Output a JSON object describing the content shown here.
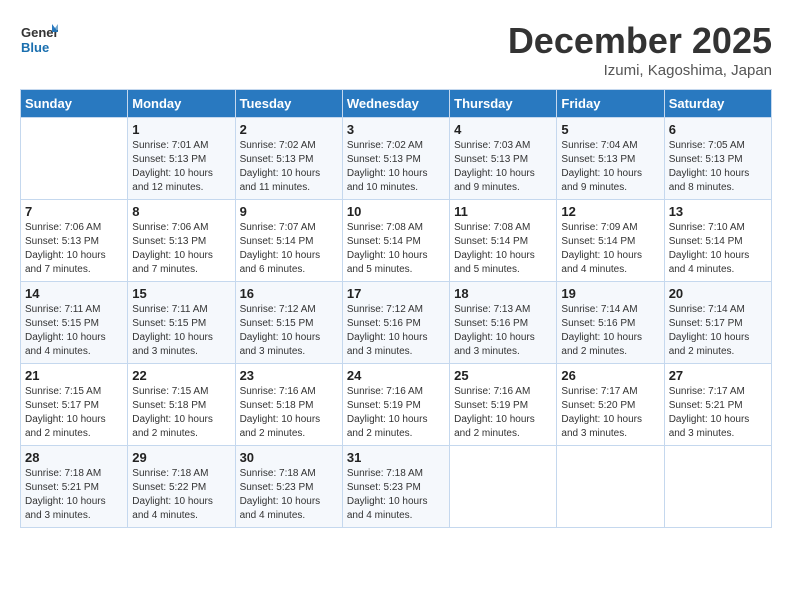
{
  "header": {
    "logo_general": "General",
    "logo_blue": "Blue",
    "month": "December 2025",
    "location": "Izumi, Kagoshima, Japan"
  },
  "columns": [
    "Sunday",
    "Monday",
    "Tuesday",
    "Wednesday",
    "Thursday",
    "Friday",
    "Saturday"
  ],
  "weeks": [
    [
      {
        "num": "",
        "sunrise": "",
        "sunset": "",
        "daylight": ""
      },
      {
        "num": "1",
        "sunrise": "Sunrise: 7:01 AM",
        "sunset": "Sunset: 5:13 PM",
        "daylight": "Daylight: 10 hours and 12 minutes."
      },
      {
        "num": "2",
        "sunrise": "Sunrise: 7:02 AM",
        "sunset": "Sunset: 5:13 PM",
        "daylight": "Daylight: 10 hours and 11 minutes."
      },
      {
        "num": "3",
        "sunrise": "Sunrise: 7:02 AM",
        "sunset": "Sunset: 5:13 PM",
        "daylight": "Daylight: 10 hours and 10 minutes."
      },
      {
        "num": "4",
        "sunrise": "Sunrise: 7:03 AM",
        "sunset": "Sunset: 5:13 PM",
        "daylight": "Daylight: 10 hours and 9 minutes."
      },
      {
        "num": "5",
        "sunrise": "Sunrise: 7:04 AM",
        "sunset": "Sunset: 5:13 PM",
        "daylight": "Daylight: 10 hours and 9 minutes."
      },
      {
        "num": "6",
        "sunrise": "Sunrise: 7:05 AM",
        "sunset": "Sunset: 5:13 PM",
        "daylight": "Daylight: 10 hours and 8 minutes."
      }
    ],
    [
      {
        "num": "7",
        "sunrise": "Sunrise: 7:06 AM",
        "sunset": "Sunset: 5:13 PM",
        "daylight": "Daylight: 10 hours and 7 minutes."
      },
      {
        "num": "8",
        "sunrise": "Sunrise: 7:06 AM",
        "sunset": "Sunset: 5:13 PM",
        "daylight": "Daylight: 10 hours and 7 minutes."
      },
      {
        "num": "9",
        "sunrise": "Sunrise: 7:07 AM",
        "sunset": "Sunset: 5:14 PM",
        "daylight": "Daylight: 10 hours and 6 minutes."
      },
      {
        "num": "10",
        "sunrise": "Sunrise: 7:08 AM",
        "sunset": "Sunset: 5:14 PM",
        "daylight": "Daylight: 10 hours and 5 minutes."
      },
      {
        "num": "11",
        "sunrise": "Sunrise: 7:08 AM",
        "sunset": "Sunset: 5:14 PM",
        "daylight": "Daylight: 10 hours and 5 minutes."
      },
      {
        "num": "12",
        "sunrise": "Sunrise: 7:09 AM",
        "sunset": "Sunset: 5:14 PM",
        "daylight": "Daylight: 10 hours and 4 minutes."
      },
      {
        "num": "13",
        "sunrise": "Sunrise: 7:10 AM",
        "sunset": "Sunset: 5:14 PM",
        "daylight": "Daylight: 10 hours and 4 minutes."
      }
    ],
    [
      {
        "num": "14",
        "sunrise": "Sunrise: 7:11 AM",
        "sunset": "Sunset: 5:15 PM",
        "daylight": "Daylight: 10 hours and 4 minutes."
      },
      {
        "num": "15",
        "sunrise": "Sunrise: 7:11 AM",
        "sunset": "Sunset: 5:15 PM",
        "daylight": "Daylight: 10 hours and 3 minutes."
      },
      {
        "num": "16",
        "sunrise": "Sunrise: 7:12 AM",
        "sunset": "Sunset: 5:15 PM",
        "daylight": "Daylight: 10 hours and 3 minutes."
      },
      {
        "num": "17",
        "sunrise": "Sunrise: 7:12 AM",
        "sunset": "Sunset: 5:16 PM",
        "daylight": "Daylight: 10 hours and 3 minutes."
      },
      {
        "num": "18",
        "sunrise": "Sunrise: 7:13 AM",
        "sunset": "Sunset: 5:16 PM",
        "daylight": "Daylight: 10 hours and 3 minutes."
      },
      {
        "num": "19",
        "sunrise": "Sunrise: 7:14 AM",
        "sunset": "Sunset: 5:16 PM",
        "daylight": "Daylight: 10 hours and 2 minutes."
      },
      {
        "num": "20",
        "sunrise": "Sunrise: 7:14 AM",
        "sunset": "Sunset: 5:17 PM",
        "daylight": "Daylight: 10 hours and 2 minutes."
      }
    ],
    [
      {
        "num": "21",
        "sunrise": "Sunrise: 7:15 AM",
        "sunset": "Sunset: 5:17 PM",
        "daylight": "Daylight: 10 hours and 2 minutes."
      },
      {
        "num": "22",
        "sunrise": "Sunrise: 7:15 AM",
        "sunset": "Sunset: 5:18 PM",
        "daylight": "Daylight: 10 hours and 2 minutes."
      },
      {
        "num": "23",
        "sunrise": "Sunrise: 7:16 AM",
        "sunset": "Sunset: 5:18 PM",
        "daylight": "Daylight: 10 hours and 2 minutes."
      },
      {
        "num": "24",
        "sunrise": "Sunrise: 7:16 AM",
        "sunset": "Sunset: 5:19 PM",
        "daylight": "Daylight: 10 hours and 2 minutes."
      },
      {
        "num": "25",
        "sunrise": "Sunrise: 7:16 AM",
        "sunset": "Sunset: 5:19 PM",
        "daylight": "Daylight: 10 hours and 2 minutes."
      },
      {
        "num": "26",
        "sunrise": "Sunrise: 7:17 AM",
        "sunset": "Sunset: 5:20 PM",
        "daylight": "Daylight: 10 hours and 3 minutes."
      },
      {
        "num": "27",
        "sunrise": "Sunrise: 7:17 AM",
        "sunset": "Sunset: 5:21 PM",
        "daylight": "Daylight: 10 hours and 3 minutes."
      }
    ],
    [
      {
        "num": "28",
        "sunrise": "Sunrise: 7:18 AM",
        "sunset": "Sunset: 5:21 PM",
        "daylight": "Daylight: 10 hours and 3 minutes."
      },
      {
        "num": "29",
        "sunrise": "Sunrise: 7:18 AM",
        "sunset": "Sunset: 5:22 PM",
        "daylight": "Daylight: 10 hours and 4 minutes."
      },
      {
        "num": "30",
        "sunrise": "Sunrise: 7:18 AM",
        "sunset": "Sunset: 5:23 PM",
        "daylight": "Daylight: 10 hours and 4 minutes."
      },
      {
        "num": "31",
        "sunrise": "Sunrise: 7:18 AM",
        "sunset": "Sunset: 5:23 PM",
        "daylight": "Daylight: 10 hours and 4 minutes."
      },
      {
        "num": "",
        "sunrise": "",
        "sunset": "",
        "daylight": ""
      },
      {
        "num": "",
        "sunrise": "",
        "sunset": "",
        "daylight": ""
      },
      {
        "num": "",
        "sunrise": "",
        "sunset": "",
        "daylight": ""
      }
    ]
  ]
}
